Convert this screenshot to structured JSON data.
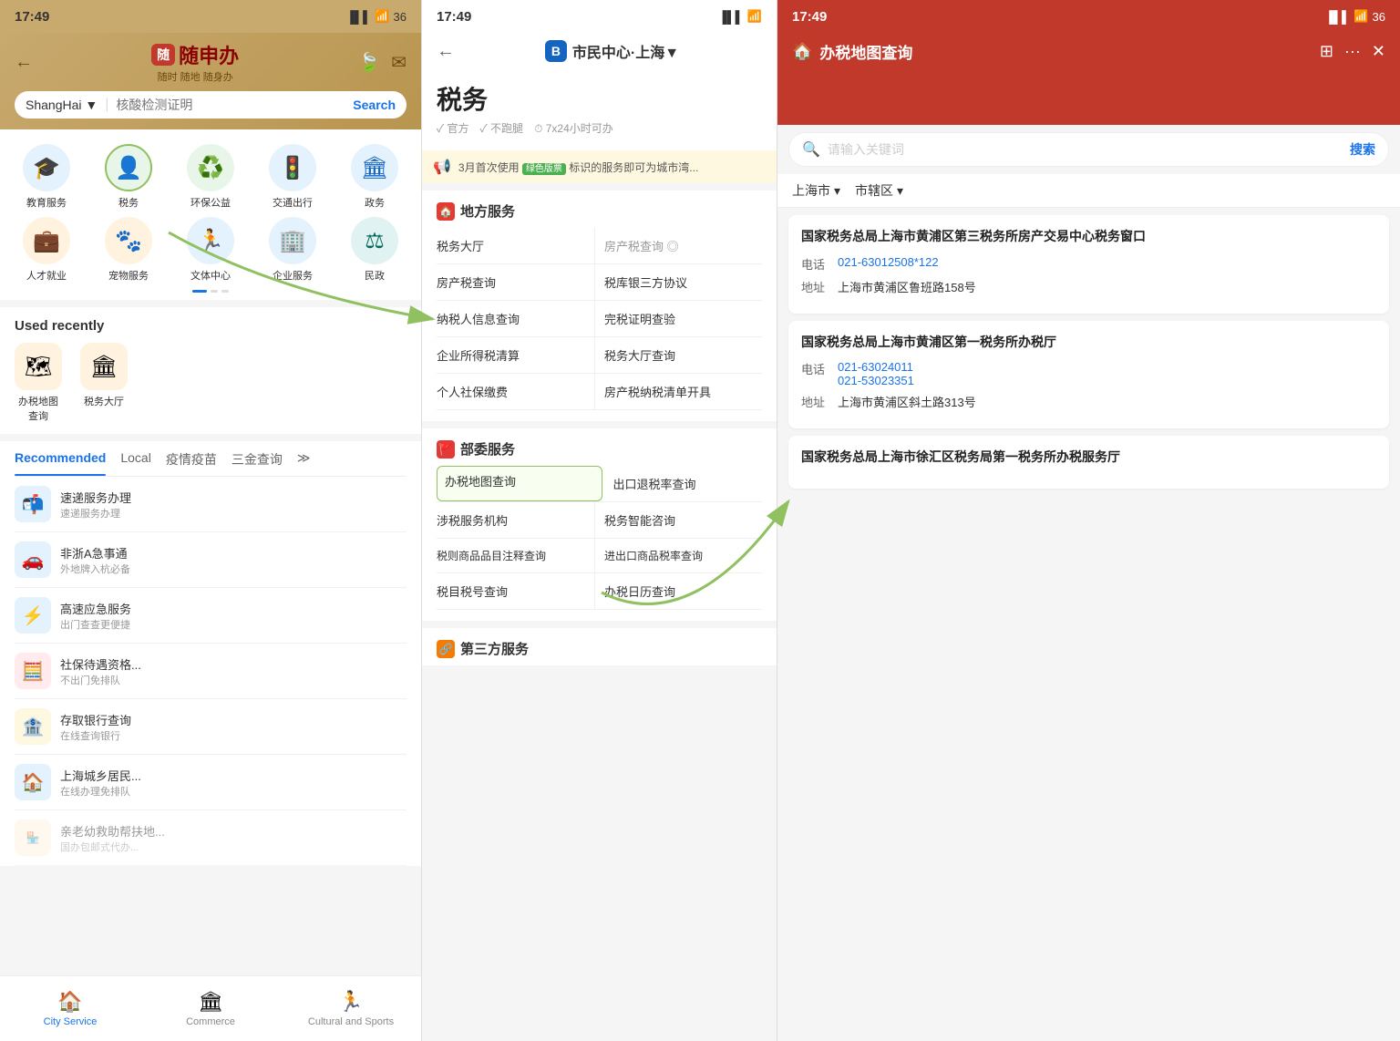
{
  "app": {
    "title": "随申办",
    "subtitle": "随时 随地 随身办",
    "status_time": "17:49"
  },
  "panel1": {
    "header": {
      "city_label": "ShangHai ▼",
      "search_placeholder": "核酸检测证明",
      "search_button": "Search",
      "back_icon": "←",
      "leaf_icon": "🍃",
      "envelope_icon": "✉"
    },
    "services": [
      {
        "label": "教育服务",
        "icon": "🎓",
        "color": "blue"
      },
      {
        "label": "税务",
        "icon": "👤",
        "color": "blue",
        "highlighted": true
      },
      {
        "label": "环保公益",
        "icon": "♻️",
        "color": "green"
      },
      {
        "label": "交通出行",
        "icon": "🚦",
        "color": "blue"
      },
      {
        "label": "政务",
        "icon": "🏛",
        "color": "blue"
      },
      {
        "label": "人才就业",
        "icon": "💼",
        "color": "orange"
      },
      {
        "label": "宠物服务",
        "icon": "🐾",
        "color": "orange"
      },
      {
        "label": "文体中心",
        "icon": "🏃",
        "color": "blue"
      },
      {
        "label": "企业服务",
        "icon": "🏢",
        "color": "blue"
      },
      {
        "label": "民政",
        "icon": "⚖",
        "color": "blue"
      }
    ],
    "recently_used": {
      "title": "Used recently",
      "items": [
        {
          "label": "办税地图\n查询",
          "icon": "🗺",
          "color": "orange"
        },
        {
          "label": "税务大厅",
          "icon": "🏛",
          "color": "orange"
        }
      ]
    },
    "tabs": [
      {
        "label": "Recommended",
        "active": true
      },
      {
        "label": "Local"
      },
      {
        "label": "疫情疫苗"
      },
      {
        "label": "三金查询"
      },
      {
        "label": "..."
      }
    ],
    "list_items": [
      {
        "icon": "📬",
        "title": "速递服务办理",
        "sub": "速递服务办理",
        "color": "blue"
      },
      {
        "icon": "🚗",
        "title": "非浙A急事通",
        "sub": "外地牌入杭必备",
        "color": "blue"
      },
      {
        "icon": "⚡",
        "title": "高速应急服务",
        "sub": "出门查查更便捷",
        "color": "blue"
      },
      {
        "icon": "🧮",
        "title": "社保待遇资格...",
        "sub": "不出门免排队",
        "color": "red"
      },
      {
        "icon": "🏦",
        "title": "存取银行查询",
        "sub": "在线查询银行",
        "color": "orange"
      },
      {
        "icon": "🏠",
        "title": "上海城乡居民...",
        "sub": "在线办理免排队",
        "color": "blue"
      }
    ],
    "bottom_nav": [
      {
        "label": "City Service",
        "icon": "🏠",
        "active": true
      },
      {
        "label": "Commerce",
        "icon": "🏛"
      },
      {
        "label": "Cultural and Sports",
        "icon": "🏃"
      }
    ]
  },
  "panel2": {
    "back_icon": "←",
    "nav_title": "市民中心·上海▼",
    "service_badge": "B",
    "main_title": "税务",
    "meta": [
      {
        "text": "官方"
      },
      {
        "text": "不跑腿"
      },
      {
        "text": "7x24小时可办"
      }
    ],
    "banner": {
      "icon": "📢",
      "text": "3月首次使用",
      "tag": "绿色版票",
      "suffix": "标识的服务即可为城市湾..."
    },
    "sections": [
      {
        "title": "地方服务",
        "icon": "🏠",
        "rows": [
          {
            "left": "税务大厅",
            "right": "房产税查询 ◎"
          },
          {
            "left": "房产税查询",
            "right": "税库银三方协议"
          },
          {
            "left": "纳税人信息查询",
            "right": "完税证明查验"
          },
          {
            "left": "企业所得税清算",
            "right": "税务大厅查询"
          },
          {
            "left": "个人社保缴费",
            "right": "房产税纳税清单开具"
          }
        ]
      },
      {
        "title": "部委服务",
        "icon": "🚩",
        "rows": [
          {
            "left": "办税地图查询",
            "right": "出口退税率查询",
            "highlight_left": true
          },
          {
            "left": "涉税服务机构",
            "right": "税务智能咨询"
          },
          {
            "left": "税则商品品目注释查询",
            "right": "进出口商品税率查询"
          },
          {
            "left": "税目税号查询",
            "right": "办税日历查询"
          }
        ]
      },
      {
        "title": "第三方服务",
        "icon": "🔗",
        "rows": []
      }
    ]
  },
  "panel3": {
    "nav_title": "办税地图查询",
    "home_icon": "🏠",
    "search_placeholder": "请输入关键词",
    "search_button": "搜索",
    "filters": [
      {
        "label": "上海市",
        "has_arrow": true
      },
      {
        "label": "市辖区",
        "has_arrow": true
      }
    ],
    "results": [
      {
        "name": "国家税务总局上海市黄浦区第三税务所房产交易中心税务窗口",
        "phone": "021-63012508*122",
        "address": "上海市黄浦区鲁班路158号"
      },
      {
        "name": "国家税务总局上海市黄浦区第一税务所办税厅",
        "phone": "021-63024011\n021-53023351",
        "address": "上海市黄浦区斜土路313号"
      },
      {
        "name": "国家税务总局上海市徐汇区税务局第一税务所办税服务厅",
        "phone": "",
        "address": ""
      }
    ]
  }
}
